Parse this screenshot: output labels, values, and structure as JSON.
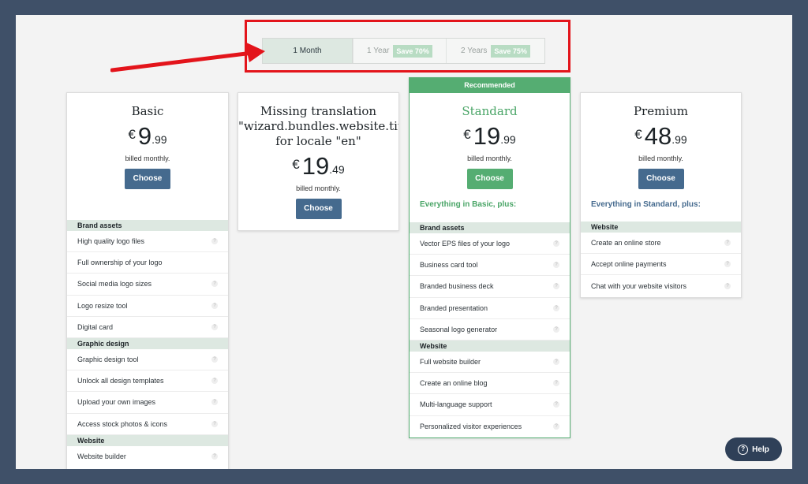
{
  "period": {
    "options": [
      {
        "label": "1 Month",
        "badge": ""
      },
      {
        "label": "1 Year",
        "badge": "Save 70%"
      },
      {
        "label": "2 Years",
        "badge": "Save 75%"
      }
    ]
  },
  "plans": {
    "basic": {
      "title": "Basic",
      "currency": "€",
      "int": "9",
      "dec": ".99",
      "billed": "billed monthly.",
      "choose": "Choose",
      "sections": [
        {
          "title": "Brand assets",
          "features": [
            "High quality logo files",
            "Full ownership of your logo",
            "Social media logo sizes",
            "Logo resize tool",
            "Digital card"
          ]
        },
        {
          "title": "Graphic design",
          "features": [
            "Graphic design tool",
            "Unlock all design templates",
            "Upload your own images",
            "Access stock photos & icons"
          ]
        },
        {
          "title": "Website",
          "features": [
            "Website builder"
          ]
        }
      ]
    },
    "missing": {
      "title_line1": "Missing translation",
      "title_line2": "\"wizard.bundles.website.title\"",
      "title_line3": "for locale \"en\"",
      "currency": "€",
      "int": "19",
      "dec": ".49",
      "billed": "billed monthly.",
      "choose": "Choose"
    },
    "standard": {
      "recommended": "Recommended",
      "title": "Standard",
      "currency": "€",
      "int": "19",
      "dec": ".99",
      "billed": "billed monthly.",
      "choose": "Choose",
      "plus": "Everything in Basic, plus:",
      "sections": [
        {
          "title": "Brand assets",
          "features": [
            "Vector EPS files of your logo",
            "Business card tool",
            "Branded business deck",
            "Branded presentation",
            "Seasonal logo generator"
          ]
        },
        {
          "title": "Website",
          "features": [
            "Full website builder",
            "Create an online blog",
            "Multi-language support",
            "Personalized visitor experiences"
          ]
        }
      ]
    },
    "premium": {
      "title": "Premium",
      "currency": "€",
      "int": "48",
      "dec": ".99",
      "billed": "billed monthly.",
      "choose": "Choose",
      "plus": "Everything in Standard, plus:",
      "sections": [
        {
          "title": "Website",
          "features": [
            "Create an online store",
            "Accept online payments",
            "Chat with your website visitors"
          ]
        }
      ]
    }
  },
  "help": {
    "label": "Help",
    "icon": "?"
  },
  "info_glyph": "?",
  "colors": {
    "accent_blue": "#456a8e",
    "accent_green": "#55ad72",
    "annotation_red": "#e3141b",
    "background": "#3f5068"
  }
}
